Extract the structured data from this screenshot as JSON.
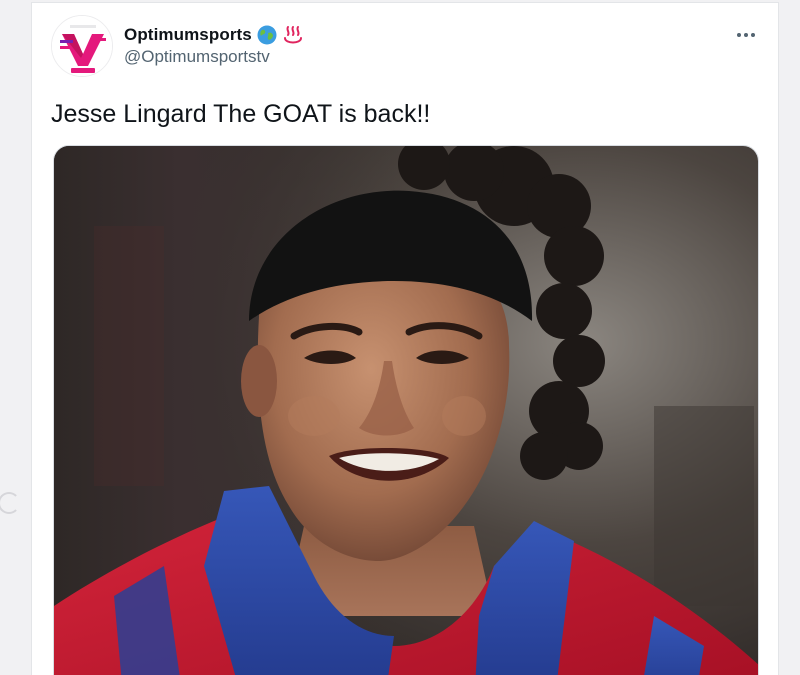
{
  "tweet": {
    "display_name": "Optimumsports",
    "handle": "@Optimumsportstv",
    "text": "Jesse Lingard The GOAT is back!!",
    "name_emojis": [
      "globe-icon",
      "hot-springs-icon"
    ],
    "more_icon": "more-icon"
  },
  "media": {
    "type": "photo"
  },
  "colors": {
    "name": "#0f1419",
    "secondary": "#536471",
    "card_border": "#e3e5e8",
    "jersey_red": "#c8102e",
    "jersey_blue": "#2a4aa8"
  }
}
